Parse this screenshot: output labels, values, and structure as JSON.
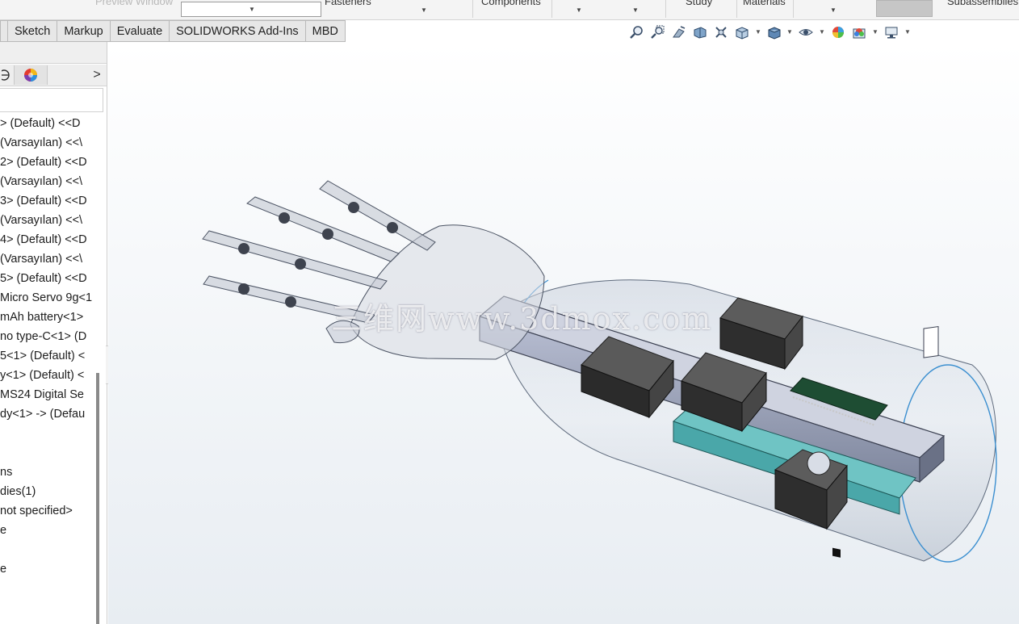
{
  "ribbon": {
    "preview_window": "Preview Window",
    "fasteners": "Fasteners",
    "components": "Components",
    "study": "Study",
    "materials": "Materials",
    "subassemblies": "Subassemblies"
  },
  "tabs": [
    "Sketch",
    "Markup",
    "Evaluate",
    "SOLIDWORKS Add-Ins",
    "MBD"
  ],
  "heads_up_toolbar": {
    "icons": [
      "zoom-to-fit-icon",
      "zoom-to-area-icon",
      "previous-view-icon",
      "section-view-icon",
      "dynamic-annotation-icon",
      "view-orientation-icon",
      "display-style-icon",
      "hide-show-items-icon",
      "edit-appearance-icon",
      "apply-scene-icon",
      "view-settings-icon"
    ]
  },
  "feature_manager": {
    "nav_arrow": ">",
    "tree": [
      "> (Default) <<D",
      "(Varsayılan) <<\\",
      "2> (Default) <<D",
      "(Varsayılan) <<\\",
      "3> (Default) <<D",
      "(Varsayılan) <<\\",
      "4> (Default) <<D",
      "(Varsayılan) <<\\",
      "5> (Default) <<D",
      "Micro Servo 9g<1",
      "mAh battery<1>",
      "no type-C<1> (D",
      "5<1> (Default) <",
      "y<1> (Default) <",
      "MS24 Digital Se",
      "dy<1> -> (Defau",
      "",
      "ns",
      "dies(1)",
      "not specified>",
      "e",
      "",
      "e"
    ]
  },
  "viewport": {
    "watermark": "三维网www.3dmox.com",
    "background_top": "#ffffff",
    "background_bottom": "#e9eef3"
  }
}
